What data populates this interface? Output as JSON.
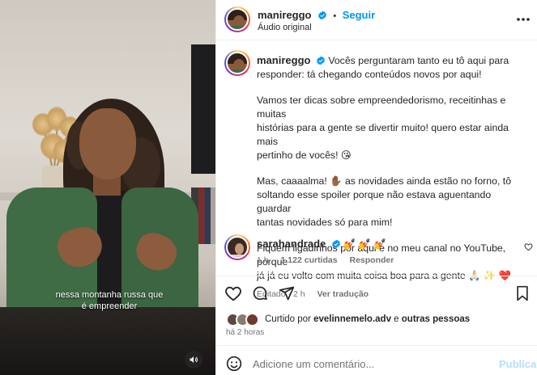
{
  "video": {
    "caption_line1": "nessa montanha russa que",
    "caption_line2": "é empreender",
    "sound_icon": "speaker-icon"
  },
  "header": {
    "username": "manireggo",
    "separator": "•",
    "follow_label": "Seguir",
    "audio_label": "Áudio original",
    "more_icon": "more-horizontal-icon"
  },
  "post": {
    "username": "manireggo",
    "line1": "Vocês perguntaram tanto eu tô aqui para",
    "line2": "responder: tá chegando conteúdos novos por aqui!",
    "para2_l1": "Vamos ter dicas sobre empreendedorismo, receitinhas e muitas",
    "para2_l2": "histórias para a gente se divertir muito! quero estar ainda mais",
    "para2_l3": "pertinho de vocês! 😘",
    "para3_l1": "Mas, caaaalma! ✋🏾 as novidades ainda estão no forno, tô",
    "para3_l2": "soltando esse spoiler porque não estava aguentando guardar",
    "para3_l3": "tantas novidades só para mim!",
    "para4_l1": "Fiquem ligadinhos por aqui e no meu canal no YouTube, porque",
    "para4_l2": "já já eu volto com muita coisa boa para a gente 🙏🏻 ✨ ❤️",
    "edited": "Editado · 2 h",
    "translate": "Ver tradução"
  },
  "comment": {
    "username": "sarahandrade",
    "text": "💅 💅 💅",
    "time": "1 h",
    "likes": "1.122 curtidas",
    "reply": "Responder"
  },
  "actions": {
    "liked_prefix": "Curtido por",
    "liked_user": "evelinnemelo.adv",
    "liked_connector": "e",
    "liked_others": "outras pessoas",
    "time_ago": "há 2 horas"
  },
  "composer": {
    "placeholder": "Adicione um comentário...",
    "publish_label": "Publicar"
  },
  "colors": {
    "accent": "#0095f6",
    "verified": "#0095f6",
    "muted": "#737373"
  }
}
